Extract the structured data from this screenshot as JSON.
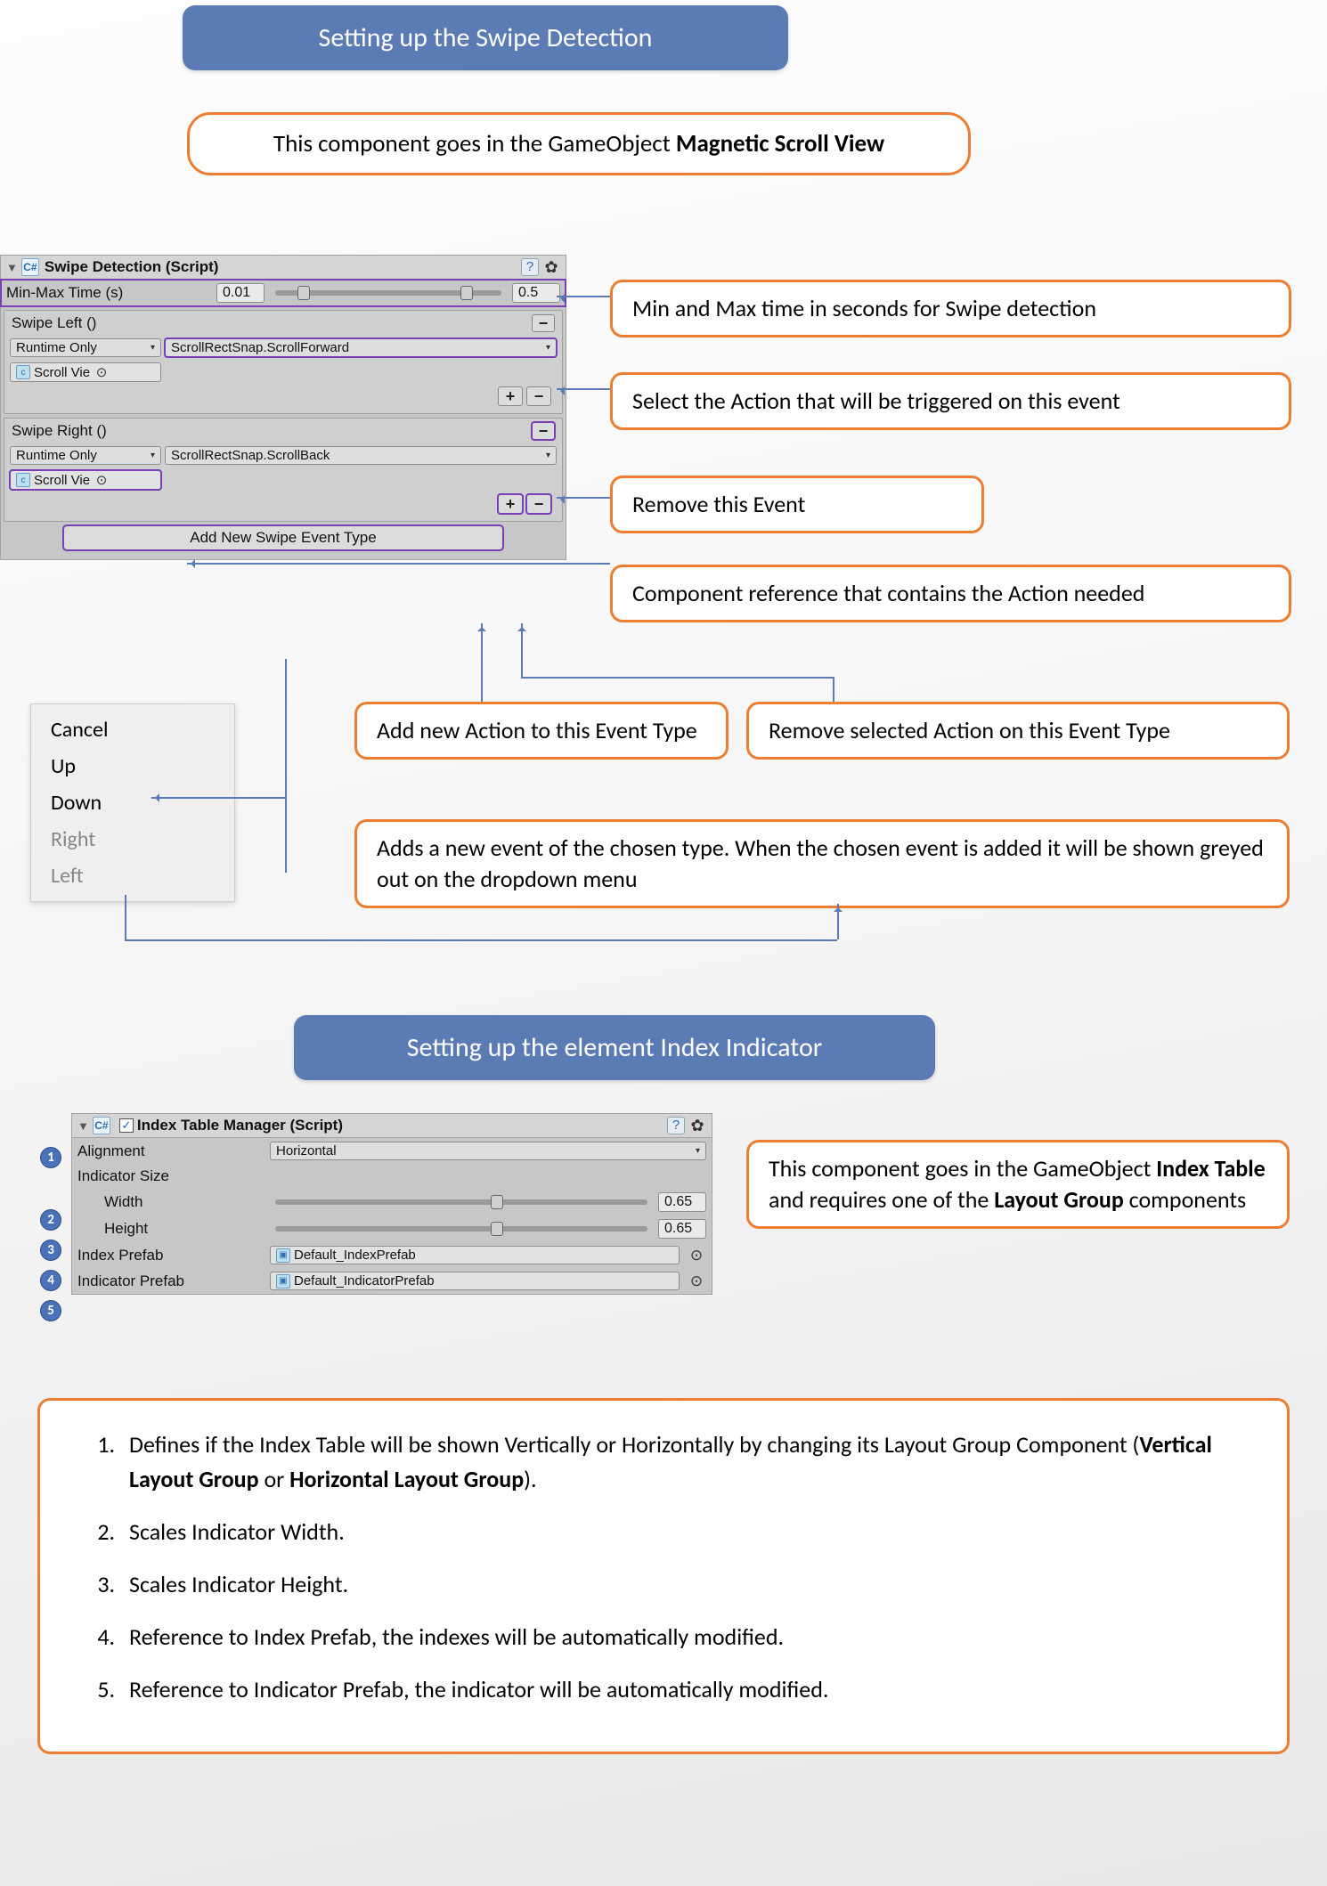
{
  "section1": {
    "title": "Setting up the Swipe Detection",
    "note_prefix": "This component goes in the GameObject ",
    "note_bold": "Magnetic Scroll View"
  },
  "swipe_panel": {
    "header": "Swipe Detection (Script)",
    "minmax_label": "Min-Max Time (s)",
    "minmax_low": "0.01",
    "minmax_high": "0.5",
    "events": [
      {
        "name": "Swipe Left ()",
        "runtime": "Runtime Only",
        "action": "ScrollRectSnap.ScrollForward",
        "obj": "Scroll Vie"
      },
      {
        "name": "Swipe Right ()",
        "runtime": "Runtime Only",
        "action": "ScrollRectSnap.ScrollBack",
        "obj": "Scroll Vie"
      }
    ],
    "add_btn": "Add New Swipe Event Type"
  },
  "callouts": {
    "c_minmax": "Min and Max time in seconds for Swipe detection",
    "c_action": "Select the Action that will be triggered on this event",
    "c_remove_event": "Remove this Event",
    "c_ref": "Component reference that contains the Action needed",
    "c_add_action": "Add new Action to this Event Type",
    "c_remove_action": "Remove selected Action on this Event Type",
    "c_add_event": "Adds a new event of the chosen type. When the chosen event is added it will be shown greyed out on the dropdown menu"
  },
  "ctx_menu": {
    "items": [
      {
        "label": "Cancel",
        "disabled": false
      },
      {
        "label": "Up",
        "disabled": false
      },
      {
        "label": "Down",
        "disabled": false
      },
      {
        "label": "Right",
        "disabled": true
      },
      {
        "label": "Left",
        "disabled": true
      }
    ]
  },
  "section2": {
    "title": "Setting up the element Index Indicator",
    "side_note_l1": "This component goes in the GameObject ",
    "side_note_b1": "Index Table",
    "side_note_l2": " and requires one of the ",
    "side_note_b2": "Layout Group",
    "side_note_l3": " components"
  },
  "index_panel": {
    "header": "Index Table Manager (Script)",
    "alignment_label": "Alignment",
    "alignment_value": "Horizontal",
    "size_label": "Indicator Size",
    "width_label": "Width",
    "width_value": "0.65",
    "height_label": "Height",
    "height_value": "0.65",
    "index_prefab_label": "Index Prefab",
    "index_prefab_value": "Default_IndexPrefab",
    "indicator_prefab_label": "Indicator Prefab",
    "indicator_prefab_value": "Default_IndicatorPrefab"
  },
  "num_list": {
    "i1a": "Defines if the Index Table will be shown Vertically or Horizontally by changing its Layout Group Component (",
    "i1b": "Vertical Layout Group",
    "i1c": " or ",
    "i1d": "Horizontal Layout Group",
    "i1e": ").",
    "i2": "Scales Indicator Width.",
    "i3": "Scales Indicator Height.",
    "i4": "Reference to Index Prefab, the indexes will be automatically modified.",
    "i5": "Reference to Indicator Prefab, the indicator will be automatically modified."
  }
}
